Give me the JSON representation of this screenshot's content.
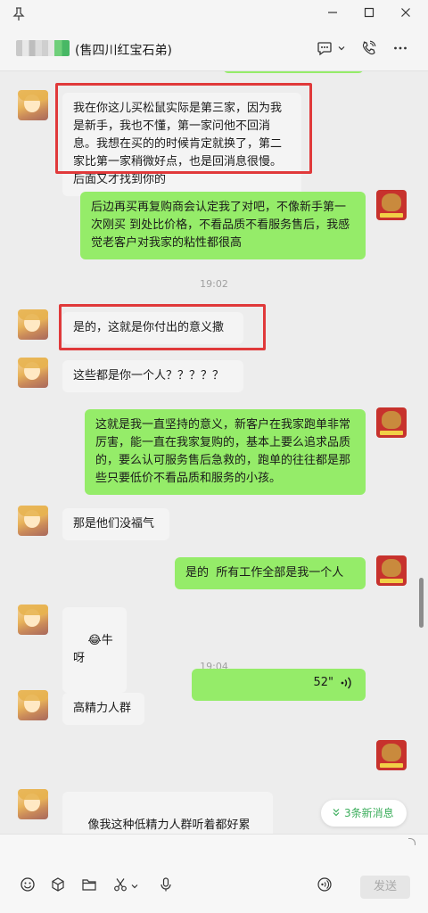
{
  "window": {
    "pin_glyph": "⊥",
    "minimize_glyph": "—",
    "maximize_glyph": "☐",
    "close_glyph": "✕"
  },
  "header": {
    "title": "(售四川红宝石弟)",
    "chat_glyph": "💬",
    "chevron": "⌄",
    "call_glyph": "✆",
    "more_glyph": "···"
  },
  "messages": [
    {
      "side": "left",
      "text": "我在你这儿买松鼠实际是第三家，因为我是新手，我也不懂，第一家问他不回消息。我想在买的的时候肯定就换了，第二家比第一家稍微好点，也是回消息很慢。后面又才找到你的",
      "highlighted": true
    },
    {
      "side": "right",
      "text": "后边再买再复购商会认定我了对吧，不像新手第一次刚买 到处比价格，不看品质不看服务售后，我感觉老客户对我家的粘性都很高"
    },
    {
      "time": "19:02"
    },
    {
      "side": "left",
      "text": "是的，这就是你付出的意义撒",
      "highlighted": true
    },
    {
      "side": "left",
      "text": "这些都是你一个人？？？？？"
    },
    {
      "side": "right",
      "text": "这就是我一直坚持的意义，新客户在我家跑单非常厉害，能一直在我家复购的，基本上要么追求品质的，要么认可服务售后急救的，跑单的往往都是那些只要低价不看品质和服务的小孩。"
    },
    {
      "side": "left",
      "text": "那是他们没福气"
    },
    {
      "side": "right",
      "text": "是的  所有工作全部是我一个人"
    },
    {
      "side": "left",
      "emoji": "😂",
      "text": "牛呀"
    },
    {
      "time": "19:04"
    },
    {
      "side": "left",
      "text": "高精力人群"
    },
    {
      "side": "right",
      "voice_duration": "52\"",
      "voice_glyph": "((·"
    },
    {
      "side": "left",
      "text": "像我这种低精力人群听着都好累",
      "emoji_suffix": "😂"
    }
  ],
  "new_messages_label": "3条新消息",
  "new_messages_glyph": "⌄⌄",
  "toolbar": {
    "emoji_glyph": "☺",
    "box_glyph": "⬡",
    "folder_glyph": "🗀",
    "scissors_glyph": "✂",
    "scissors_chevron": "⌄",
    "mic_glyph": "🎙",
    "voice_call_glyph": "◉",
    "send_label": "发送"
  },
  "colors": {
    "sent_bubble": "#95ec69",
    "received_bubble": "#f4f4f4",
    "highlight_border": "#e0393a",
    "accent_green": "#3cae5c"
  }
}
